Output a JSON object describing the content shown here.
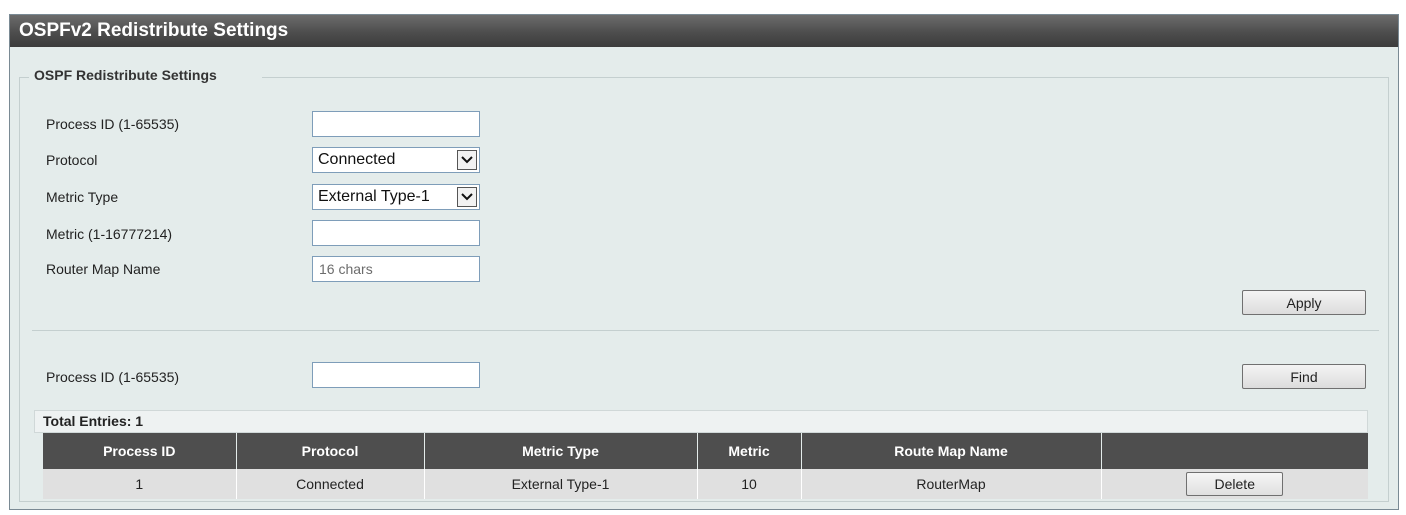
{
  "page": {
    "title": "OSPFv2 Redistribute Settings"
  },
  "settings": {
    "legend": "OSPF Redistribute Settings",
    "process_id": {
      "label": "Process ID (1-65535)",
      "value": "",
      "placeholder": ""
    },
    "protocol": {
      "label": "Protocol",
      "value": "Connected"
    },
    "metric_type": {
      "label": "Metric Type",
      "value": "External Type-1"
    },
    "metric": {
      "label": "Metric (1-16777214)",
      "value": "",
      "placeholder": ""
    },
    "router_map": {
      "label": "Router Map Name",
      "value": "",
      "placeholder": "16 chars"
    },
    "apply_label": "Apply"
  },
  "search": {
    "process_id": {
      "label": "Process ID (1-65535)",
      "value": "",
      "placeholder": ""
    },
    "find_label": "Find"
  },
  "table": {
    "total_entries": "Total Entries: 1",
    "headers": [
      "Process ID",
      "Protocol",
      "Metric Type",
      "Metric",
      "Route Map Name",
      ""
    ],
    "rows": [
      {
        "process_id": "1",
        "protocol": "Connected",
        "metric_type": "External Type-1",
        "metric": "10",
        "route_map_name": "RouterMap",
        "action_label": "Delete"
      }
    ]
  },
  "icons": {
    "dropdown": "chevron-down-icon"
  },
  "colors": {
    "title_bar": "#4d4d4d",
    "panel_bg": "#e4eceb",
    "table_header": "#4e4e4e",
    "table_row": "#e0e0e0"
  }
}
